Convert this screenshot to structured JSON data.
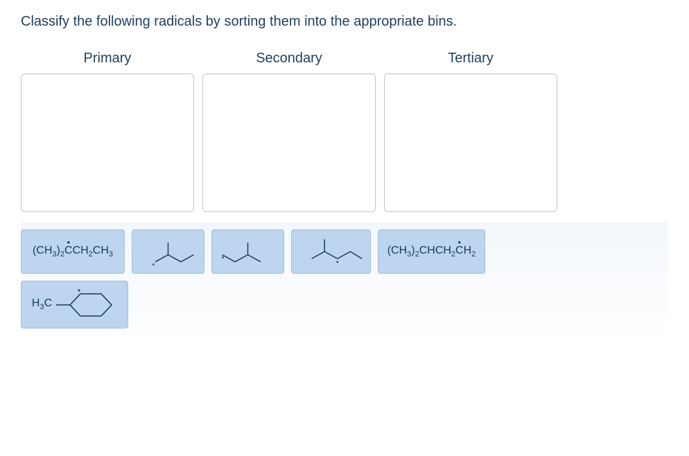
{
  "question": "Classify the following radicals by sorting them into the appropriate bins.",
  "bins": {
    "primary": "Primary",
    "secondary": "Secondary",
    "tertiary": "Tertiary"
  },
  "items": {
    "formula1_prefix": "(CH",
    "formula1_sub1": "3",
    "formula1_close": ")",
    "formula1_sub2": "2",
    "formula1_radC": "C",
    "formula1_ch2": "CH",
    "formula1_sub3": "2",
    "formula1_ch3": "CH",
    "formula1_sub4": "3",
    "formula5_prefix": "(CH",
    "formula5_sub1": "3",
    "formula5_close": ")",
    "formula5_sub2": "2",
    "formula5_chc": "CHCH",
    "formula5_sub3": "2",
    "formula5_radC": "C",
    "formula5_h2": "H",
    "formula5_sub4": "2",
    "h3c_label_h": "H",
    "h3c_label_3": "3",
    "h3c_label_c": "C"
  }
}
